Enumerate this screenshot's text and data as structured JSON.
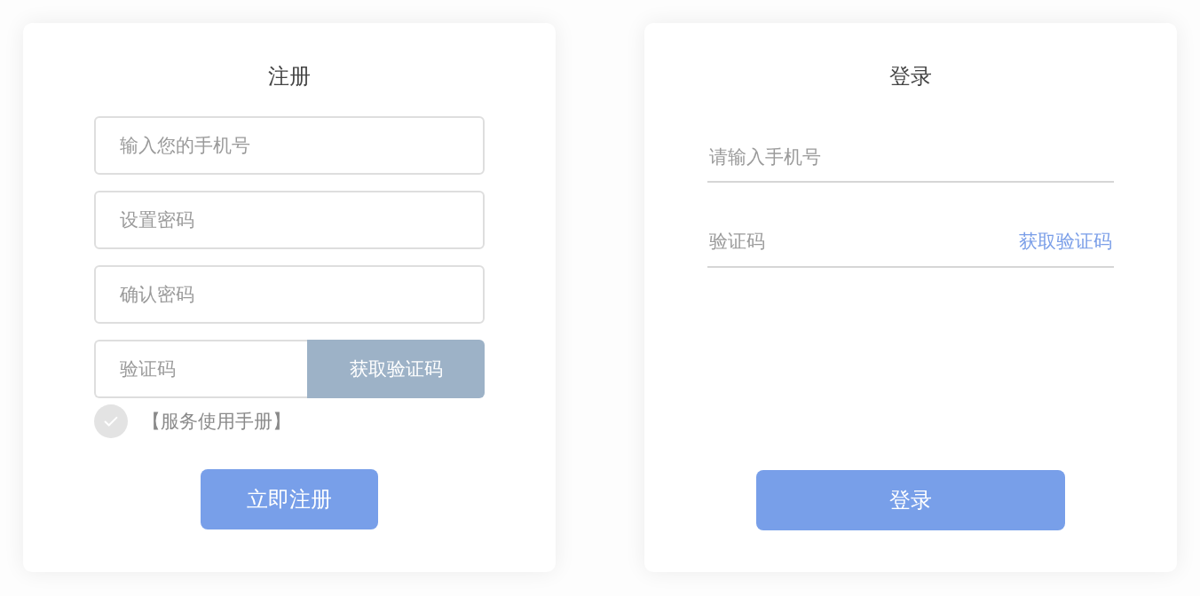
{
  "register": {
    "title": "注册",
    "fields": [
      {
        "placeholder": "输入您的手机号"
      },
      {
        "placeholder": "设置密码"
      },
      {
        "placeholder": "确认密码"
      }
    ],
    "code_field": {
      "placeholder": "验证码",
      "button": "获取验证码"
    },
    "agreement": {
      "label": "【服务使用手册】",
      "checked": false
    },
    "submit": "立即注册"
  },
  "login": {
    "title": "登录",
    "fields": [
      {
        "placeholder": "请输入手机号"
      }
    ],
    "code_field": {
      "placeholder": "验证码",
      "link": "获取验证码"
    },
    "submit": "登录"
  }
}
